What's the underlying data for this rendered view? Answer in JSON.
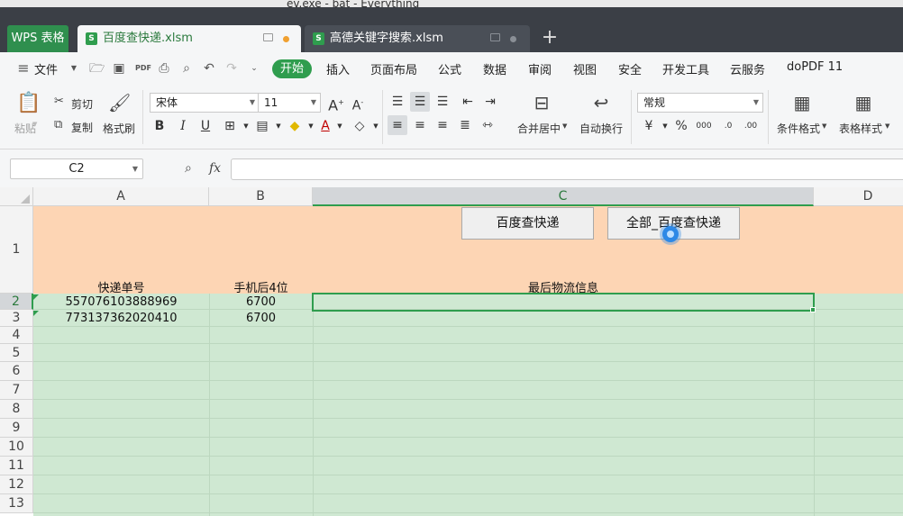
{
  "background_window": {
    "title": "ev.exe - bat - Everything"
  },
  "tabs": {
    "app_label": "WPS 表格",
    "documents": [
      {
        "name": "百度查快递.xlsm",
        "active": true,
        "status_dot_color": "#f0a030"
      },
      {
        "name": "高德关键字搜索.xlsm",
        "active": false,
        "status_dot_color": "#8a8f96"
      }
    ],
    "new_tab": "+"
  },
  "menu": {
    "file_label": "文件",
    "start_label": "开始",
    "items": [
      "插入",
      "页面布局",
      "公式",
      "数据",
      "审阅",
      "视图",
      "安全",
      "开发工具",
      "云服务",
      "doPDF 11"
    ]
  },
  "ribbon": {
    "paste": "粘贴",
    "cut": "剪切",
    "copy": "复制",
    "format_painter": "格式刷",
    "font_name": "宋体",
    "font_size": "11",
    "merge_center": "合并居中",
    "wrap_text": "自动换行",
    "number_format": "常规",
    "percent": "%",
    "conditional_format": "条件格式",
    "table_style": "表格样式"
  },
  "formula_bar": {
    "cell_ref": "C2",
    "fx_label": "fx",
    "formula": ""
  },
  "sheet": {
    "columns": [
      "A",
      "B",
      "C",
      "D"
    ],
    "selected_column": "C",
    "rows": [
      "1",
      "2",
      "3",
      "4",
      "5",
      "6",
      "7",
      "8",
      "9",
      "10",
      "11",
      "12",
      "13"
    ],
    "selected_row": "2",
    "headers": {
      "a1": "快递单号",
      "b1": "手机后4位",
      "c1": "最后物流信息"
    },
    "data": [
      {
        "tracking": "557076103888969",
        "phone_last4": "6700",
        "info": ""
      },
      {
        "tracking": "773137362020410",
        "phone_last4": "6700",
        "info": ""
      }
    ],
    "buttons": {
      "query": "百度查快递",
      "query_all": "全部_百度查快递"
    },
    "colors": {
      "header_fill": "#fdd5b4",
      "data_fill": "#cfe8d2",
      "accent": "#2f9d4e"
    }
  }
}
